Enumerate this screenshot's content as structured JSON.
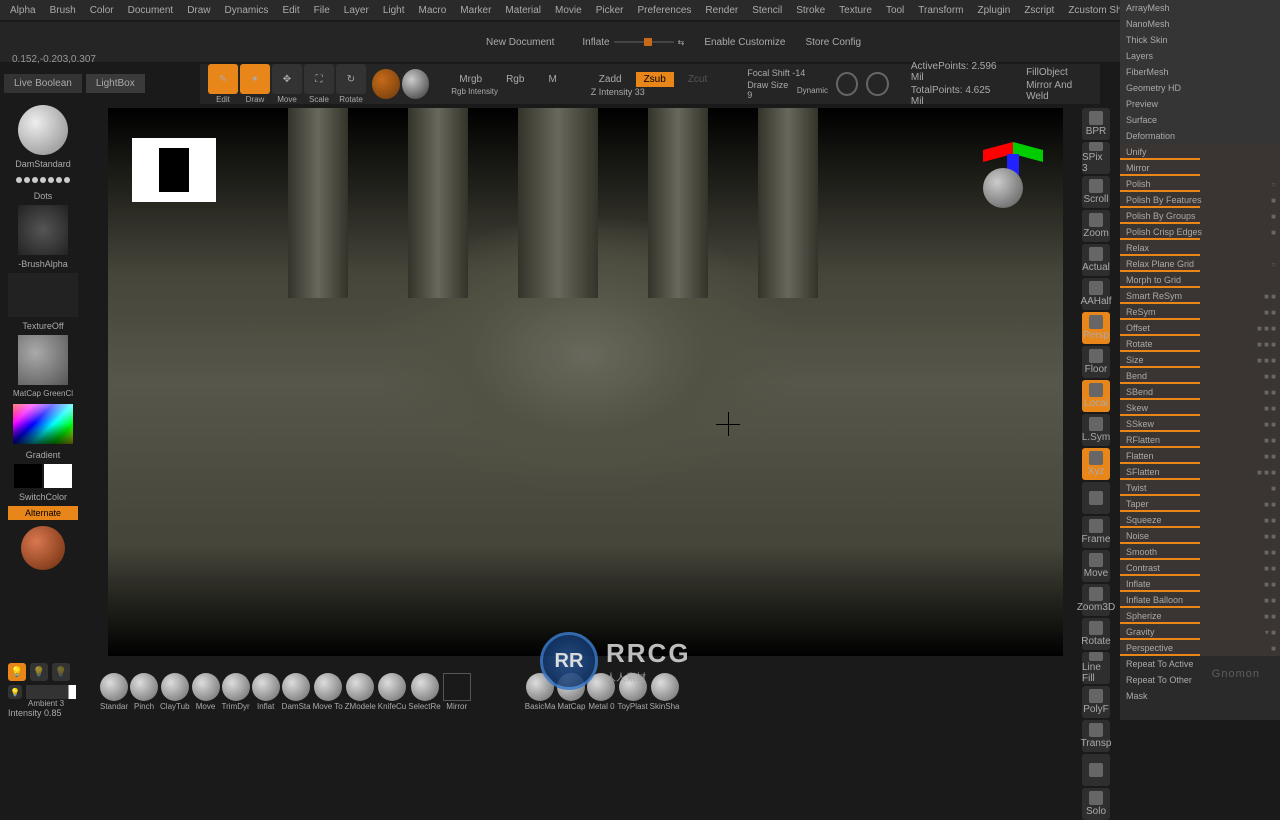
{
  "menu": [
    "Alpha",
    "Brush",
    "Color",
    "Document",
    "Draw",
    "Dynamics",
    "Edit",
    "File",
    "Layer",
    "Light",
    "Macro",
    "Marker",
    "Material",
    "Movie",
    "Picker",
    "Preferences",
    "Render",
    "Stencil",
    "Stroke",
    "Texture",
    "Tool",
    "Transform",
    "Zplugin",
    "Zscript",
    "Zcustom Shit"
  ],
  "coords": "0.152,-0.203,0.307",
  "topbar": {
    "newdoc": "New Document",
    "inflate": "Inflate",
    "enable": "Enable Customize",
    "storecfg": "Store Config"
  },
  "botbtns": {
    "livebool": "Live Boolean",
    "lightbox": "LightBox"
  },
  "tools": {
    "edit": "Edit",
    "draw": "Draw",
    "move": "Move",
    "scale": "Scale",
    "rotate": "Rotate"
  },
  "modes": {
    "mrgb": "Mrgb",
    "rgb": "Rgb",
    "m": "M",
    "rgbint": "Rgb Intensity",
    "zadd": "Zadd",
    "zsub": "Zsub",
    "zcut": "Zcut",
    "zint": "Z Intensity 33"
  },
  "focal": {
    "shift": "Focal Shift -14",
    "draw": "Draw Size 9",
    "dyn": "Dynamic"
  },
  "info": {
    "active": "ActivePoints: 2.596 Mil",
    "total": "TotalPoints: 4.625 Mil",
    "fill": "FillObject",
    "mirror": "Mirror And Weld"
  },
  "left": {
    "brush": "DamStandard",
    "dots": "Dots",
    "alpha": "-BrushAlpha",
    "tex": "TextureOff",
    "mat": "MatCap GreenCl",
    "grad": "Gradient",
    "switch": "SwitchColor",
    "alt": "Alternate",
    "amb": "Ambient 3",
    "intensity": "Intensity 0.85"
  },
  "rtools": [
    "BPR",
    "SPix 3",
    "Scroll",
    "Zoom",
    "Actual",
    "AAHalf",
    "Persp",
    "Floor",
    "Local",
    "L.Sym",
    "Xyz",
    "",
    "Frame",
    "Move",
    "Zoom3D",
    "Rotate",
    "Line Fill",
    "PolyF",
    "Transp",
    "",
    "Solo"
  ],
  "rpanel": [
    {
      "t": "ArrayMesh",
      "h": 1
    },
    {
      "t": "NanoMesh",
      "h": 1
    },
    {
      "t": "Thick Skin",
      "h": 1
    },
    {
      "t": "Layers",
      "h": 1
    },
    {
      "t": "FiberMesh",
      "h": 1
    },
    {
      "t": "Geometry HD",
      "h": 1
    },
    {
      "t": "Preview",
      "h": 1
    },
    {
      "t": "Surface",
      "h": 1
    },
    {
      "t": "Deformation",
      "h": 1
    },
    {
      "t": "Unify",
      "s": 1
    },
    {
      "t": "Mirror",
      "s": 1
    },
    {
      "t": "Polish",
      "s": 1,
      "i": "○"
    },
    {
      "t": "Polish By Features",
      "s": 1,
      "i": "■"
    },
    {
      "t": "Polish By Groups",
      "s": 1,
      "i": "■"
    },
    {
      "t": "Polish Crisp Edges",
      "s": 1,
      "i": "■"
    },
    {
      "t": "Relax",
      "s": 1
    },
    {
      "t": "Relax Plane Grid",
      "s": 1,
      "i": "○"
    },
    {
      "t": "Morph to Grid",
      "s": 1
    },
    {
      "t": "Smart ReSym",
      "s": 1,
      "i": "■ ■"
    },
    {
      "t": "ReSym",
      "s": 1,
      "i": "■ ■"
    },
    {
      "t": "Offset",
      "s": 1,
      "i": "■ ■ ■"
    },
    {
      "t": "Rotate",
      "s": 1,
      "i": "■ ■ ■"
    },
    {
      "t": "Size",
      "s": 1,
      "i": "■ ■ ■"
    },
    {
      "t": "Bend",
      "s": 1,
      "i": "■ ■"
    },
    {
      "t": "SBend",
      "s": 1,
      "i": "■ ■"
    },
    {
      "t": "Skew",
      "s": 1,
      "i": "■ ■"
    },
    {
      "t": "SSkew",
      "s": 1,
      "i": "■ ■"
    },
    {
      "t": "RFlatten",
      "s": 1,
      "i": "■ ■"
    },
    {
      "t": "Flatten",
      "s": 1,
      "i": "■ ■"
    },
    {
      "t": "SFlatten",
      "s": 1,
      "i": "■ ■ ■"
    },
    {
      "t": "Twist",
      "s": 1,
      "i": "■"
    },
    {
      "t": "Taper",
      "s": 1,
      "i": "■ ■"
    },
    {
      "t": "Squeeze",
      "s": 1,
      "i": "■ ■"
    },
    {
      "t": "Noise",
      "s": 1,
      "i": "■ ■"
    },
    {
      "t": "Smooth",
      "s": 1,
      "i": "■ ■"
    },
    {
      "t": "Contrast",
      "s": 1,
      "i": "■ ■"
    },
    {
      "t": "Inflate",
      "s": 1,
      "i": "■ ■"
    },
    {
      "t": "Inflate Balloon",
      "s": 1,
      "i": "■ ■"
    },
    {
      "t": "Spherize",
      "s": 1,
      "i": "■ ■"
    },
    {
      "t": "Gravity",
      "s": 1,
      "i": "▾ ■"
    },
    {
      "t": "Perspective",
      "s": 1,
      "i": "■"
    },
    {
      "t": "Repeat To Active"
    },
    {
      "t": "Repeat To Other"
    },
    {
      "t": "Mask"
    }
  ],
  "shelf": [
    "Standar",
    "Pinch",
    "ClayTub",
    "Move",
    "TrimDyr",
    "Inflat",
    "DamSta",
    "Move To",
    "ZModele",
    "KnifeCu",
    "SelectRe"
  ],
  "shelf2": {
    "mirror": "Mirror",
    "mats": [
      "BasicMa",
      "MatCap",
      "Metal 0",
      "ToyPlast",
      "SkinSha"
    ]
  },
  "wm": {
    "logo": "RR",
    "text": "RRCG",
    "sub": "人人素材"
  },
  "gnomon": "Gnomon"
}
